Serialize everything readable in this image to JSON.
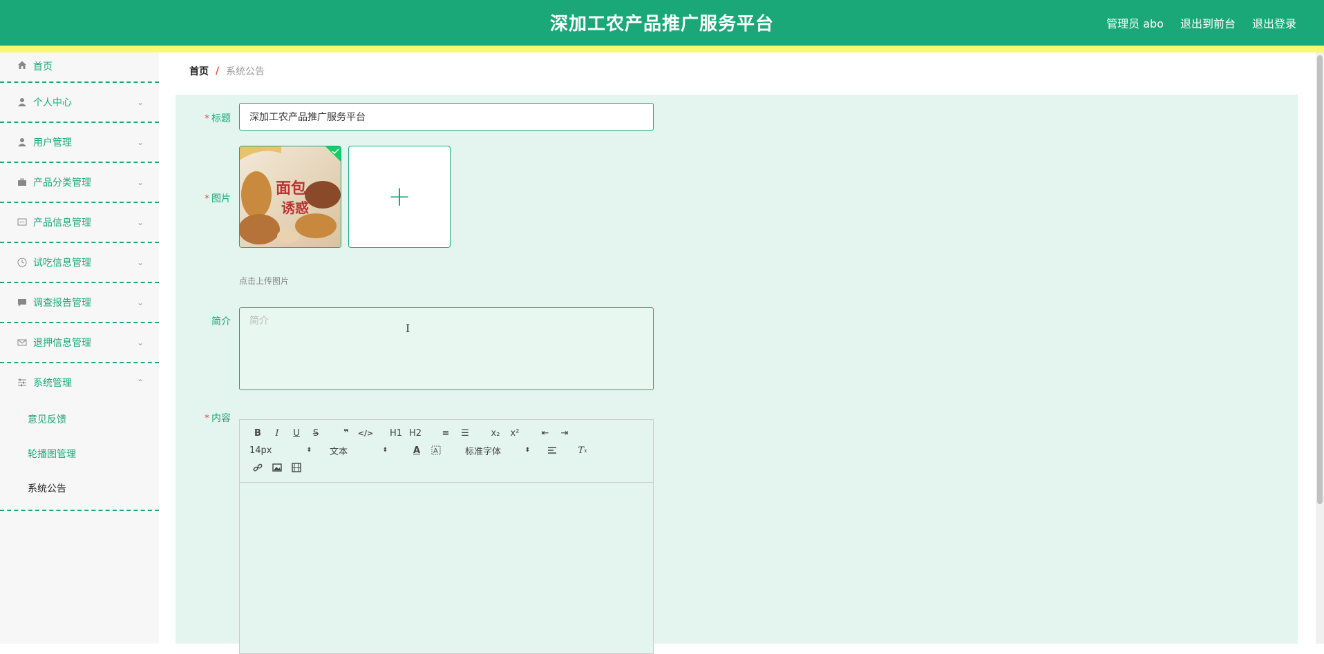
{
  "header": {
    "title": "深加工农产品推广服务平台",
    "user": "管理员 abo",
    "to_front": "退出到前台",
    "logout": "退出登录"
  },
  "sidebar": {
    "items": [
      {
        "label": "首页",
        "icon": "home-icon"
      },
      {
        "label": "个人中心",
        "icon": "user-icon"
      },
      {
        "label": "用户管理",
        "icon": "user-icon"
      },
      {
        "label": "产品分类管理",
        "icon": "briefcase-icon"
      },
      {
        "label": "产品信息管理",
        "icon": "message-icon"
      },
      {
        "label": "试吃信息管理",
        "icon": "clock-icon"
      },
      {
        "label": "调查报告管理",
        "icon": "chat-icon"
      },
      {
        "label": "退押信息管理",
        "icon": "mail-icon"
      },
      {
        "label": "系统管理",
        "icon": "settings-sliders-icon"
      }
    ],
    "sub_items": [
      "意见反馈",
      "轮播图管理",
      "系统公告"
    ],
    "active_sub": "系统公告"
  },
  "breadcrumb": {
    "home": "首页",
    "separator": "/",
    "current": "系统公告"
  },
  "form": {
    "required_mark": "*",
    "title_label": "标题",
    "title_value": "深加工农产品推广服务平台",
    "image_label": "图片",
    "upload_plus": "+",
    "upload_hint": "点击上传图片",
    "intro_label": "简介",
    "intro_placeholder": "简介",
    "content_label": "内容"
  },
  "editor": {
    "font_size": "14px",
    "header_select": "文本",
    "font_family": "标准字体",
    "buttons": [
      "B",
      "I",
      "U",
      "S",
      "❞",
      "</>",
      "H1",
      "H2",
      "≡",
      "☰",
      "x₂",
      "x²",
      "⇤",
      "⇥"
    ]
  },
  "colors": {
    "primary": "#1aa879",
    "accent_bar": "#f8f872",
    "required": "#e64a3b",
    "form_bg": "#e3f5ee"
  }
}
